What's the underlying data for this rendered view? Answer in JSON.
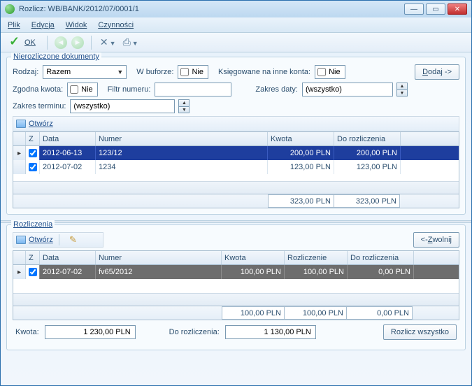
{
  "window": {
    "title": "Rozlicz: WB/BANK/2012/07/0001/1"
  },
  "menu": {
    "plik": "Plik",
    "edycja": "Edycja",
    "widok": "Widok",
    "czynnosci": "Czynności"
  },
  "toolbar": {
    "ok": "OK"
  },
  "group1": {
    "title": "Nierozliczone dokumenty",
    "rodzaj_label": "Rodzaj:",
    "rodzaj_value": "Razem",
    "wbuforze_label": "W buforze:",
    "wbuforze_value": "Nie",
    "ksiegowane_label": "Księgowane na inne konta:",
    "ksiegowane_value": "Nie",
    "dodaj": "Dodaj ->",
    "zgodna_label": "Zgodna kwota:",
    "zgodna_value": "Nie",
    "filtr_label": "Filtr numeru:",
    "zakresdaty_label": "Zakres daty:",
    "zakresdaty_value": "(wszystko)",
    "zakresterminu_label": "Zakres terminu:",
    "zakresterminu_value": "(wszystko)",
    "otworz": "Otwórz"
  },
  "grid1": {
    "head": {
      "z": "Z",
      "data": "Data",
      "numer": "Numer",
      "kwota": "Kwota",
      "dorozl": "Do rozliczenia"
    },
    "rows": [
      {
        "sel": true,
        "checked": true,
        "data": "2012-06-13",
        "numer": "123/12",
        "kwota": "200,00 PLN",
        "dorozl": "200,00 PLN"
      },
      {
        "sel": false,
        "checked": true,
        "data": "2012-07-02",
        "numer": "1234",
        "kwota": "123,00 PLN",
        "dorozl": "123,00 PLN"
      }
    ],
    "foot": {
      "kwota": "323,00 PLN",
      "dorozl": "323,00 PLN"
    }
  },
  "group2": {
    "title": "Rozliczenia",
    "otworz": "Otwórz",
    "zwolnij": "<- Zwolnij"
  },
  "grid2": {
    "head": {
      "z": "Z",
      "data": "Data",
      "numer": "Numer",
      "kwota": "Kwota",
      "rozl": "Rozliczenie",
      "dorozl": "Do rozliczenia"
    },
    "rows": [
      {
        "sel": true,
        "checked": true,
        "data": "2012-07-02",
        "numer": "fv65/2012",
        "kwota": "100,00 PLN",
        "rozl": "100,00 PLN",
        "dorozl": "0,00 PLN"
      }
    ],
    "foot": {
      "kwota": "100,00 PLN",
      "rozl": "100,00 PLN",
      "dorozl": "0,00 PLN"
    }
  },
  "bottom": {
    "kwota_label": "Kwota:",
    "kwota_value": "1 230,00 PLN",
    "dorozl_label": "Do rozliczenia:",
    "dorozl_value": "1 130,00 PLN",
    "rozlicz": "Rozlicz wszystko"
  }
}
